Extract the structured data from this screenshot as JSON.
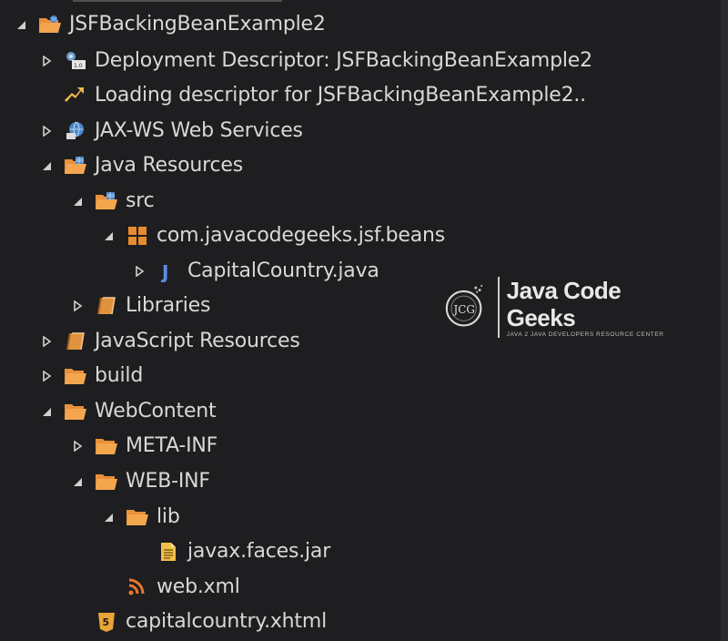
{
  "tree": {
    "items": [
      {
        "label": "JSFBackingBeanExample2",
        "icon": "web-project-icon",
        "expanded": true
      },
      {
        "label": "Deployment Descriptor: JSFBackingBeanExample2",
        "icon": "deployment-descriptor-icon",
        "expanded": false
      },
      {
        "label": "Loading descriptor for JSFBackingBeanExample2..",
        "icon": "loading-icon"
      },
      {
        "label": "JAX-WS Web Services",
        "icon": "web-services-icon",
        "expanded": false
      },
      {
        "label": "Java Resources",
        "icon": "java-resources-icon",
        "expanded": true
      },
      {
        "label": "src",
        "icon": "source-folder-icon",
        "expanded": true
      },
      {
        "label": "com.javacodegeeks.jsf.beans",
        "icon": "package-icon",
        "expanded": true
      },
      {
        "label": "CapitalCountry.java",
        "icon": "java-file-icon",
        "expanded": false
      },
      {
        "label": "Libraries",
        "icon": "libraries-icon",
        "expanded": false
      },
      {
        "label": "JavaScript Resources",
        "icon": "javascript-resources-icon",
        "expanded": false
      },
      {
        "label": "build",
        "icon": "folder-icon",
        "expanded": false
      },
      {
        "label": "WebContent",
        "icon": "folder-icon",
        "expanded": true
      },
      {
        "label": "META-INF",
        "icon": "folder-icon",
        "expanded": false
      },
      {
        "label": "WEB-INF",
        "icon": "folder-icon",
        "expanded": true
      },
      {
        "label": "lib",
        "icon": "folder-icon",
        "expanded": true
      },
      {
        "label": "javax.faces.jar",
        "icon": "jar-file-icon"
      },
      {
        "label": "web.xml",
        "icon": "xml-file-icon"
      },
      {
        "label": "capitalcountry.xhtml",
        "icon": "html5-file-icon"
      }
    ]
  },
  "watermark": {
    "logo_text": "JCG",
    "name": "Java Code Geeks",
    "tagline": "JAVA 2 JAVA DEVELOPERS RESOURCE CENTER"
  },
  "colors": {
    "background": "#1e1e20",
    "text": "#d8d8d8",
    "folder": "#e8913a",
    "package": "#e88a2e",
    "java_j": "#5b8ee6"
  }
}
